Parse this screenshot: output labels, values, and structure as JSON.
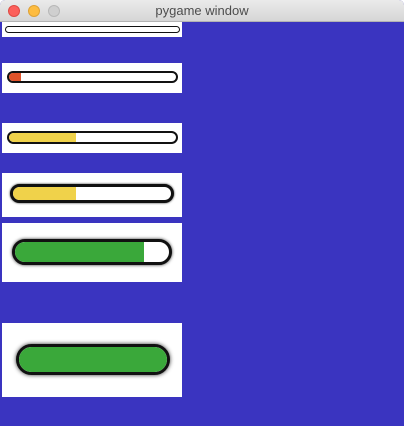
{
  "window": {
    "title": "pygame window"
  },
  "colors": {
    "background": "#3a34c0",
    "outline": "#111111",
    "red": "#e0532a",
    "yellow": "#f0d24a",
    "green": "#3aa83a"
  },
  "bars": [
    {
      "name": "progress-bar-1",
      "progress": 0.0,
      "color": "red"
    },
    {
      "name": "progress-bar-2",
      "progress": 0.07,
      "color": "red"
    },
    {
      "name": "progress-bar-3",
      "progress": 0.4,
      "color": "yellow"
    },
    {
      "name": "progress-bar-4",
      "progress": 0.4,
      "color": "yellow"
    },
    {
      "name": "progress-bar-5",
      "progress": 0.84,
      "color": "green"
    },
    {
      "name": "progress-bar-6",
      "progress": 1.0,
      "color": "green"
    }
  ]
}
